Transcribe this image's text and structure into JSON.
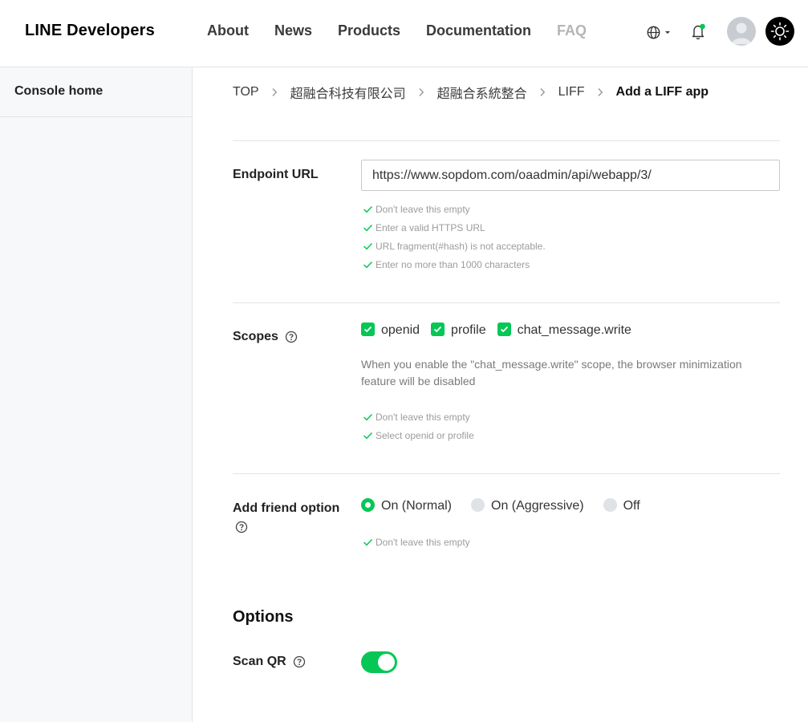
{
  "header": {
    "logo": "LINE Developers",
    "nav": [
      "About",
      "News",
      "Products",
      "Documentation",
      "FAQ"
    ],
    "notification_dot_color": "#06c755"
  },
  "sidebar": {
    "items": [
      {
        "label": "Console home"
      }
    ]
  },
  "breadcrumb": {
    "items": [
      "TOP",
      "超融合科技有限公司",
      "超融合系統整合",
      "LIFF"
    ],
    "current": "Add a LIFF app"
  },
  "endpoint": {
    "label": "Endpoint URL",
    "value": "https://www.sopdom.com/oaadmin/api/webapp/3/",
    "hints": [
      "Don't leave this empty",
      "Enter a valid HTTPS URL",
      "URL fragment(#hash) is not acceptable.",
      "Enter no more than 1000 characters"
    ]
  },
  "scopes": {
    "label": "Scopes",
    "options": [
      {
        "label": "openid",
        "checked": true
      },
      {
        "label": "profile",
        "checked": true
      },
      {
        "label": "chat_message.write",
        "checked": true
      }
    ],
    "note": "When you enable the \"chat_message.write\" scope, the browser minimization feature will be disabled",
    "hints": [
      "Don't leave this empty",
      "Select openid or profile"
    ]
  },
  "friend_option": {
    "label": "Add friend option",
    "options": [
      {
        "label": "On (Normal)",
        "selected": true
      },
      {
        "label": "On (Aggressive)",
        "selected": false
      },
      {
        "label": "Off",
        "selected": false
      }
    ],
    "hints": [
      "Don't leave this empty"
    ]
  },
  "options": {
    "title": "Options",
    "scan_qr": {
      "label": "Scan QR",
      "enabled": true
    }
  },
  "colors": {
    "accent": "#06c755",
    "hint_check": "#06c755"
  }
}
